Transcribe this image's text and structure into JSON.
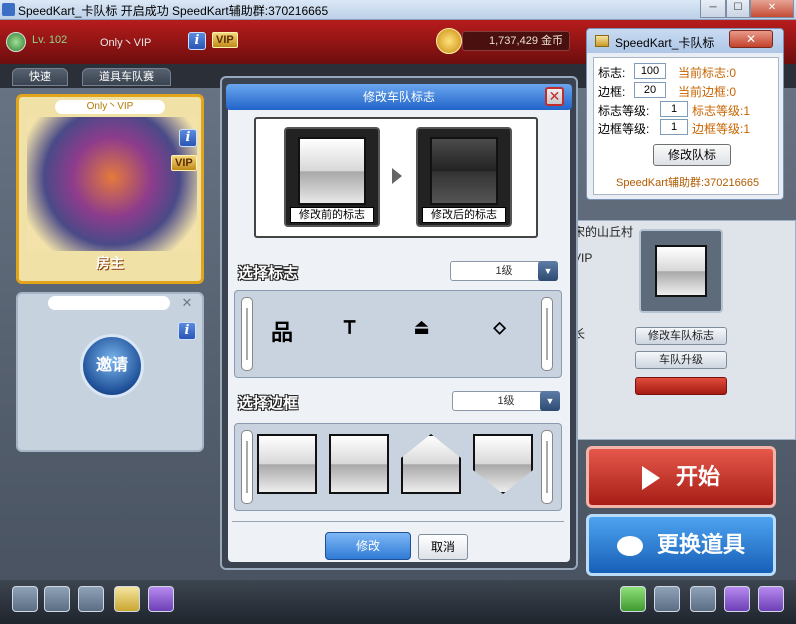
{
  "window": {
    "title": "SpeedKart_卡队标 开启成功  SpeedKart辅助群:370216665",
    "btn_min": "─",
    "btn_max": "☐",
    "btn_close": "✕"
  },
  "top": {
    "level": "Lv. 102",
    "player": "Only丶VIP",
    "vip": "VIP",
    "gold": "1,737,429 金币"
  },
  "tabs": [
    "快速",
    "道具车队赛"
  ],
  "card": {
    "name": "Only丶VIP",
    "role": "房主",
    "vip": "VIP"
  },
  "invite": "邀请",
  "right": {
    "buttons": [
      "修改车队标志",
      "车队升级"
    ],
    "list": [
      "宋的山丘村",
      "VIP",
      "长"
    ]
  },
  "start": "开始",
  "items": "更换道具",
  "dialog": {
    "title": "修改车队标志",
    "before": "修改前的标志",
    "after": "修改后的标志",
    "choose_logo": "选择标志",
    "logo_level": "1级",
    "choose_frame": "选择边框",
    "frame_level": "1级",
    "ok": "修改",
    "cancel": "取消"
  },
  "tool": {
    "title": "SpeedKart_卡队标",
    "logo_label": "标志:",
    "logo_value": "100",
    "logo_current": "当前标志:0",
    "frame_label": "边框:",
    "frame_value": "20",
    "frame_current": "当前边框:0",
    "logo_level_label": "标志等级:",
    "logo_level_value": "1",
    "logo_level_current": "标志等级:1",
    "frame_level_label": "边框等级:",
    "frame_level_value": "1",
    "frame_level_current": "边框等级:1",
    "button": "修改队标",
    "footer": "SpeedKart辅助群:370216665"
  }
}
